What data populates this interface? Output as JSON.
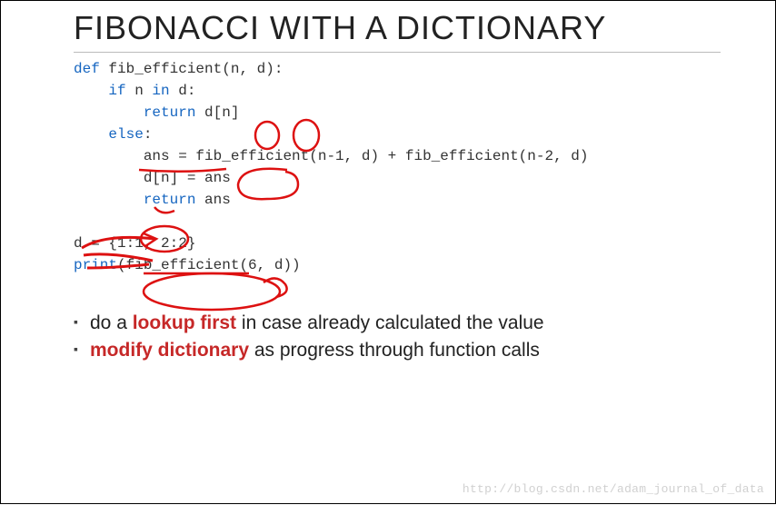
{
  "title": "FIBONACCI WITH A DICTIONARY",
  "code": {
    "l1_def": "def",
    "l1_fn": " fib_efficient",
    "l1_paren_open": "(",
    "l1_arg_n": "n",
    "l1_comma": ", ",
    "l1_arg_d": "d",
    "l1_paren_close": "):",
    "l2_if": "    if ",
    "l2_cond_n": "n ",
    "l2_in": "in",
    "l2_cond_d": " d:",
    "l3_return": "        return ",
    "l3_expr": "d[n]",
    "l4_else": "    else",
    "l4_colon": ":",
    "l5_ans": "        ans ",
    "l5_eq": "= fib_efficient(n-1, d) + fib_efficient(n-2, d)",
    "l6_dn": "        d[n] ",
    "l6_eq": "= ans",
    "l7_return": "        return ",
    "l7_ans": "ans",
    "blank": "",
    "l8": "d = {1:1, 2:2}",
    "l9_print": "print",
    "l9_rest": "(fib_efficient(6, d))"
  },
  "bullets": [
    {
      "pre": "do a ",
      "em": "lookup first",
      "post": " in case already calculated the value"
    },
    {
      "pre": "",
      "em": "modify dictionary",
      "post": " as progress through function calls"
    }
  ],
  "watermark": "http://blog.csdn.net/adam_journal_of_data"
}
